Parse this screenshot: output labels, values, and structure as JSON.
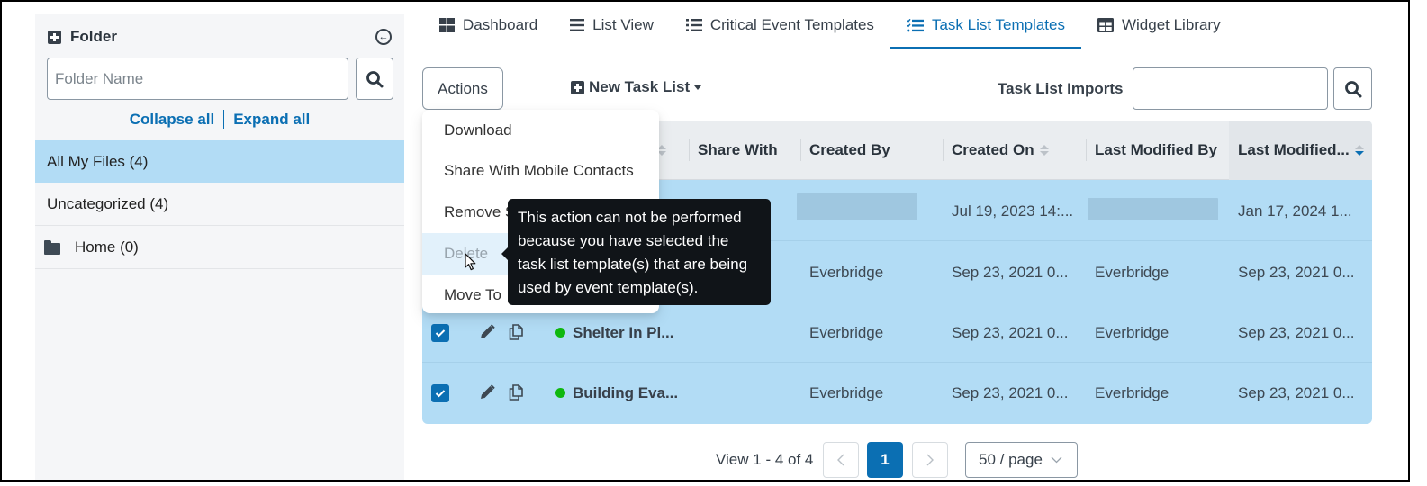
{
  "sidebar": {
    "title": "Folder",
    "search_placeholder": "Folder Name",
    "search_value": "",
    "collapse_all": "Collapse all",
    "expand_all": "Expand all",
    "items": [
      {
        "label": "All My Files (4)",
        "active": true
      },
      {
        "label": "Uncategorized (4)",
        "active": false
      },
      {
        "label": "Home (0)",
        "active": false,
        "icon": "folder-icon"
      }
    ]
  },
  "tabs": [
    {
      "label": "Dashboard",
      "icon": "grid-icon",
      "active": false
    },
    {
      "label": "List View",
      "icon": "list-icon",
      "active": false
    },
    {
      "label": "Critical Event Templates",
      "icon": "bulleted-list-icon",
      "active": false
    },
    {
      "label": "Task List Templates",
      "icon": "checklist-icon",
      "active": true
    },
    {
      "label": "Widget Library",
      "icon": "table-icon",
      "active": false
    }
  ],
  "toolbar": {
    "actions_label": "Actions",
    "new_task_list_label": "New Task List",
    "imports_label": "Task List Imports",
    "imports_value": ""
  },
  "actions_menu": {
    "items": [
      {
        "label": "Download",
        "disabled": false
      },
      {
        "label": "Share With Mobile Contacts",
        "disabled": false
      },
      {
        "label": "Remove Share",
        "disabled": false
      },
      {
        "label": "Delete",
        "disabled": true
      },
      {
        "label": "Move To",
        "disabled": false
      }
    ],
    "visible_labels": [
      "Download",
      "Share With Mobile Contacts",
      "Remove S",
      "Delete",
      "Move To"
    ]
  },
  "tooltip": {
    "text": "This action can not be performed because you have selected the task list template(s) that are being used by event template(s)."
  },
  "table": {
    "columns": [
      {
        "label": ".",
        "sortable": true,
        "sort": "none"
      },
      {
        "label": "Share With",
        "sortable": false
      },
      {
        "label": "Created By",
        "sortable": false
      },
      {
        "label": "Created On",
        "sortable": true,
        "sort": "none"
      },
      {
        "label": "Last Modified By",
        "sortable": false
      },
      {
        "label": "Last Modified...",
        "sortable": true,
        "sort": "descending"
      }
    ],
    "rows": [
      {
        "checked": true,
        "name": "",
        "status": "active",
        "share_with": "",
        "created_by": "[redacted]",
        "created_on": "Jul 19, 2023 14:...",
        "last_modified_by": "[redacted]",
        "last_modified": "Jan 17, 2024 1..."
      },
      {
        "checked": true,
        "name": "",
        "status": "active",
        "share_with": "",
        "created_by": "Everbridge",
        "created_on": "Sep 23, 2021 0...",
        "last_modified_by": "Everbridge",
        "last_modified": "Sep 23, 2021 0..."
      },
      {
        "checked": true,
        "name": "Shelter In Pl...",
        "status": "active",
        "share_with": "",
        "created_by": "Everbridge",
        "created_on": "Sep 23, 2021 0...",
        "last_modified_by": "Everbridge",
        "last_modified": "Sep 23, 2021 0..."
      },
      {
        "checked": true,
        "name": "Building Eva...",
        "status": "active",
        "share_with": "",
        "created_by": "Everbridge",
        "created_on": "Sep 23, 2021 0...",
        "last_modified_by": "Everbridge",
        "last_modified": "Sep 23, 2021 0..."
      }
    ]
  },
  "pagination": {
    "view_text": "View 1 - 4 of 4",
    "current_page": "1",
    "prev_label": "<",
    "next_label": ">",
    "page_size": "50 / page"
  },
  "colors": {
    "accent": "#0b6fb3",
    "selected_row": "#b2dcf5",
    "status_active": "#0fb80f",
    "tooltip_bg": "#101418"
  }
}
